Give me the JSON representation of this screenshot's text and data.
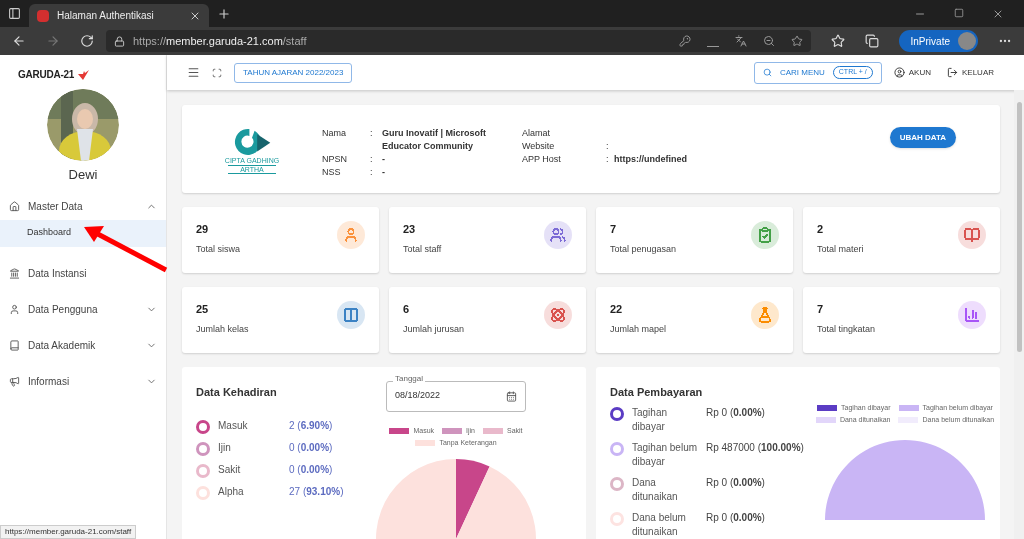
{
  "browser": {
    "tab_title": "Halaman Authentikasi",
    "address": {
      "scheme": "https://",
      "host": "member.garuda-21.com",
      "path": "/staff"
    },
    "inprivate": "InPrivate"
  },
  "sidebar": {
    "brand": "GARUDA-21",
    "user_name": "Dewi",
    "items": [
      {
        "label": "Master Data",
        "expanded": true,
        "children": [
          {
            "label": "Dashboard",
            "selected": true
          }
        ]
      },
      {
        "label": "Data Instansi"
      },
      {
        "label": "Data Pengguna",
        "expanded": false
      },
      {
        "label": "Data Akademik",
        "expanded": false
      },
      {
        "label": "Informasi",
        "expanded": false
      }
    ]
  },
  "topbar": {
    "year_button": "TAHUN AJARAN 2022/2023",
    "search_button": "CARI MENU",
    "search_shortcut": "CTRL + /",
    "account": "AKUN",
    "logout": "KELUAR"
  },
  "profile": {
    "logo_text": "CIPTA GADHING",
    "logo_subtext": "ARTHA",
    "fields_left": [
      {
        "label": "Nama",
        "separator": ":",
        "value": "Guru Inovatif | Microsoft Educator Community"
      },
      {
        "label": "NPSN",
        "separator": ":",
        "value": "-"
      },
      {
        "label": "NSS",
        "separator": ":",
        "value": "-"
      }
    ],
    "fields_right": [
      {
        "label": "Alamat"
      },
      {
        "label": "Website",
        "separator": ":"
      },
      {
        "label": "APP Host",
        "separator": ":",
        "value": "https://undefined"
      }
    ],
    "edit_button": "UBAH DATA"
  },
  "stats": [
    {
      "value": "29",
      "label": "Total siswa",
      "color": "#fb923c"
    },
    {
      "value": "23",
      "label": "Total staff",
      "color": "#7c6bd6"
    },
    {
      "value": "7",
      "label": "Total penugasan",
      "color": "#43a047"
    },
    {
      "value": "2",
      "label": "Total materi",
      "color": "#d9534f"
    },
    {
      "value": "25",
      "label": "Jumlah kelas",
      "color": "#3b82c4"
    },
    {
      "value": "6",
      "label": "Jumlah jurusan",
      "color": "#d9534f"
    },
    {
      "value": "22",
      "label": "Jumlah mapel",
      "color": "#fb8c00"
    },
    {
      "value": "7",
      "label": "Total tingkatan",
      "color": "#a855f7"
    }
  ],
  "attendance": {
    "title": "Data Kehadiran",
    "date_field": {
      "label": "Tanggal",
      "value": "08/18/2022"
    },
    "items": [
      {
        "label": "Masuk",
        "value": "2 (**6.90%**)",
        "color": "#c8468a"
      },
      {
        "label": "Ijin",
        "value": "0 (**0.00%**)",
        "color": "#cf94bd"
      },
      {
        "label": "Sakit",
        "value": "0 (**0.00%**)",
        "color": "#e9b9cb"
      },
      {
        "label": "Alpha",
        "value": "27 (**93.10%**)",
        "color": "#fde1dd"
      }
    ],
    "chart_data": {
      "type": "pie",
      "categories": [
        "Masuk",
        "Ijin",
        "Sakit",
        "Tanpa Keterangan"
      ],
      "series": [
        {
          "colors": [
            "#c8468a",
            "#cf94bd",
            "#e9b9cb",
            "#fde1dd"
          ],
          "values": [
            6.9,
            0,
            0,
            93.1
          ]
        }
      ]
    }
  },
  "payment": {
    "title": "Data Pembayaran",
    "items": [
      {
        "label": "Tagihan dibayar",
        "value": "Rp 0 (**0.00%**)",
        "color": "#5b3cc4"
      },
      {
        "label": "Tagihan belum dibayar",
        "value": "Rp 487000 (**100.00%**)",
        "color": "#c9b5f5"
      },
      {
        "label": "Dana ditunaikan",
        "value": "Rp 0 (**0.00%**)",
        "color": "#dcb6c6"
      },
      {
        "label": "Dana belum ditunaikan",
        "value": "Rp 0 (**0.00%**)",
        "color": "#fde3e1"
      }
    ],
    "chart_data": {
      "type": "pie",
      "categories": [
        "Tagihan dibayar",
        "Tagihan belum dibayar",
        "Dana ditunaikan",
        "Dana belum ditunaikan"
      ],
      "series": [
        {
          "colors": [
            "#5b3cc4",
            "#c9b5f5",
            "#e2d6fa",
            "#f1ecfc"
          ],
          "values": [
            0,
            100,
            0,
            0
          ]
        }
      ]
    }
  },
  "status_url": "https://member.garuda-21.com/staff"
}
